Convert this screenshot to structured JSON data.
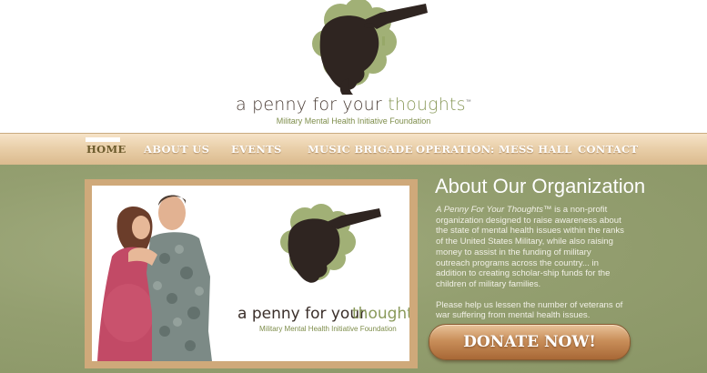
{
  "brand": {
    "name_prefix": "a penny for your",
    "name_accent": "thoughts",
    "trademark": "™",
    "subtitle": "Military Mental Health Initiative Foundation"
  },
  "nav": {
    "items": [
      {
        "label": "HOME",
        "active": true
      },
      {
        "label": "ABOUT US",
        "active": false
      },
      {
        "label": "EVENTS",
        "active": false
      },
      {
        "label": "MUSIC BRIGADE",
        "active": false
      },
      {
        "label": "OPERATION: MESS HALL",
        "active": false
      },
      {
        "label": "CONTACT",
        "active": false
      }
    ]
  },
  "photo": {
    "brand_prefix": "a penny for your",
    "brand_accent": "thoughts",
    "brand_subtitle": "Military Mental Health Initiative Foundation"
  },
  "about": {
    "title": "About Our Organization",
    "org_name": "A Penny For Your Thoughts™",
    "body_1": " is a non-profit organization designed to raise awareness about the state of mental health issues within the ranks of the United States Military, while also raising money to assist in the funding of military outreach programs across the country... in addition to creating scholar-ship funds for the children of military families.",
    "body_2": "Please help us lessen the number of veterans of war suffering from mental health issues."
  },
  "donate": {
    "label": "DONATE NOW!"
  },
  "colors": {
    "olive": "#949f70",
    "tan": "#e2c49a",
    "accent_green": "#8a9a5b",
    "dark_brown": "#2f2521"
  }
}
